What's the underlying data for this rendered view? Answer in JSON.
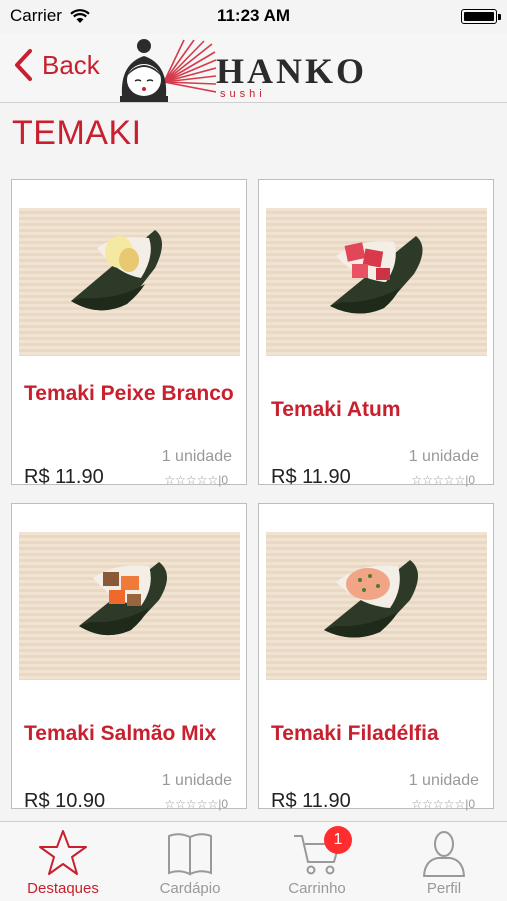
{
  "status_bar": {
    "carrier": "Carrier",
    "time": "11:23 AM"
  },
  "navbar": {
    "back_label": "Back",
    "brand": "HANKO",
    "brand_sub": "sushi"
  },
  "section_title": "TEMAKI",
  "products": [
    {
      "name": "Temaki Peixe Branco",
      "unit": "1 unidade",
      "price": "R$ 11.90",
      "rating_count": "|0"
    },
    {
      "name": "Temaki Atum",
      "unit": "1 unidade",
      "price": "R$ 11.90",
      "rating_count": "|0"
    },
    {
      "name": "Temaki Salmão Mix",
      "unit": "1 unidade",
      "price": "R$ 10.90",
      "rating_count": "|0"
    },
    {
      "name": "Temaki Filadélfia",
      "unit": "1 unidade",
      "price": "R$ 11.90",
      "rating_count": "|0"
    }
  ],
  "tabs": [
    {
      "label": "Destaques",
      "icon": "star-icon"
    },
    {
      "label": "Cardápio",
      "icon": "book-icon"
    },
    {
      "label": "Carrinho",
      "icon": "cart-icon",
      "badge": "1"
    },
    {
      "label": "Perfil",
      "icon": "person-icon"
    }
  ],
  "colors": {
    "accent": "#c8202f",
    "badge": "#ff2d2d",
    "inactive": "#999999"
  }
}
